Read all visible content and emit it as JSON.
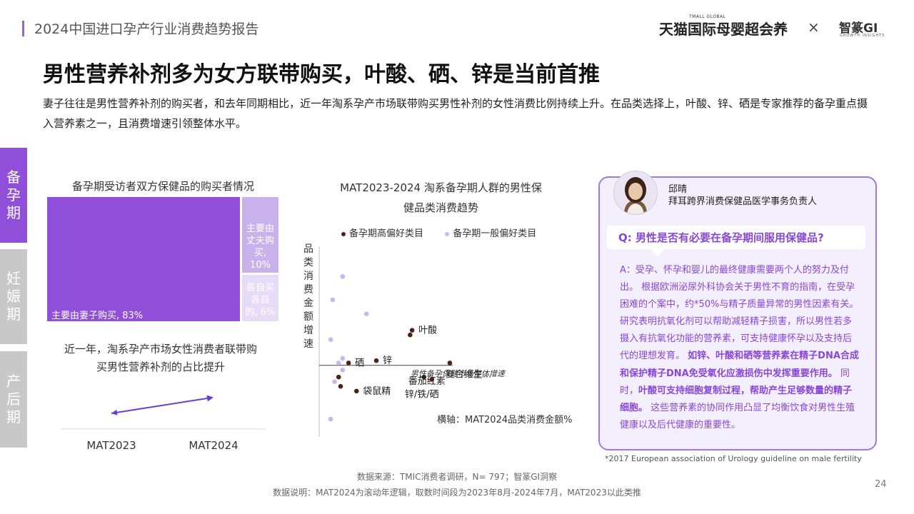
{
  "header": {
    "report_title": "2024中国进口孕产行业消费趋势报告",
    "brand_small": "TMALL GLOBAL",
    "brand_tmall": "天猫国际母婴超会养",
    "brand_x": "×",
    "brand_gi": "智篆GI",
    "brand_gi_sub": "GROWTH INSIGHTS"
  },
  "main_title": "男性营养补剂多为女方联带购买，叶酸、硒、锌是当前首推",
  "intro": "妻子往往是男性营养补剂的购买者，和去年同期相比，近一年淘系孕产市场联带购买男性补剂的女性消费比例持续上升。在品类选择上，叶酸、锌、硒是专家推荐的备孕重点摄入营养素之一，且消费增速引领整体水平。",
  "side_tabs": [
    {
      "label": "备孕期",
      "active": true
    },
    {
      "label": "妊娠期",
      "active": false
    },
    {
      "label": "产后期",
      "active": false
    }
  ],
  "colors": {
    "accent": "#8f4fd9",
    "accent_light": "#c9b2ec",
    "accent_lighter": "#e7dcf7",
    "dark_dot": "#4a2418",
    "light_dot": "#c8b6ee",
    "line": "#6a3fd0",
    "tab_inactive": "#c8c8c8"
  },
  "expert": {
    "name": "邱晴",
    "title": "拜耳跨界消费保健品医学事务负责人",
    "question": "Q:  男性是否有必要在备孕期间服用保健品?",
    "answer_plain_1": "A：受孕、怀孕和婴儿的最终健康需要两个人的努力及付出。 根据欧洲泌尿外科协会关于男性不育的指南，在受孕困难的个案中，约*50%与精子质量异常的男性因素有关。研究表明抗氧化剂可以帮助减轻精子损害，所以男性若多摄入有抗氧化功能的营养素，可支持健康怀孕以及支持后代的理想发育。",
    "answer_bold_1": "如锌、叶酸和硒等营养素在精子DNA合成和保护精子DNA免受氧化应激损伤中发挥重要作用。",
    "answer_plain_2": "同时，",
    "answer_bold_2": "叶酸可支持细胞复制过程，帮助产生足够数量的精子细胞。",
    "answer_plain_3": "这些营养素的协同作用凸显了均衡饮食对男性生殖健康以及后代健康的重要性。"
  },
  "footnote": "*2017 European association of Urology guideline on male fertility",
  "source": "数据来源：TMIC消费者调研，N= 797；智篆GI洞察",
  "source_note": "数据说明：MAT2024为滚动年逻辑，取数时间段为2023年8月-2024年7月，MAT2023以此类推",
  "page_number": "24",
  "chart_data": [
    {
      "type": "treemap",
      "title": "备孕期受访者双方保健品的购买者情况",
      "items": [
        {
          "label": "主要由妻子购买, 83%",
          "value": 83
        },
        {
          "label": "主要由丈夫购买, 10%",
          "value": 10
        },
        {
          "label": "各自买各自的, 6%",
          "value": 6
        }
      ]
    },
    {
      "type": "line",
      "caption": "近一年，淘系孕产市场女性消费者联带购买男性营养补剂的占比提升",
      "categories": [
        "MAT2023",
        "MAT2024"
      ],
      "values": [
        0.3,
        0.62
      ],
      "ylim": [
        0,
        1
      ]
    },
    {
      "type": "scatter",
      "title": "MAT2023-2024 淘系备孕期人群的男性保健品类消费趋势",
      "xlabel": "横轴：MAT2024品类消费金额%",
      "ylabel": "品类消费金额增速",
      "xlim": [
        0,
        100
      ],
      "ylim": [
        -30,
        50
      ],
      "reference_line": {
        "label": "男性备孕保健市场整体增速",
        "y": 0
      },
      "series": [
        {
          "name": "备孕期高偏好类目",
          "points": [
            {
              "x": 45,
              "y": 15,
              "label": "叶酸"
            },
            {
              "x": 44,
              "y": 13,
              "label": ""
            },
            {
              "x": 13,
              "y": 1,
              "label": "硒"
            },
            {
              "x": 8,
              "y": -5,
              "label": ""
            },
            {
              "x": 27,
              "y": 2,
              "label": "锌"
            },
            {
              "x": 51,
              "y": -5,
              "label": "番茄红素"
            },
            {
              "x": 64,
              "y": 1,
              "label": "复合维生..."
            },
            {
              "x": 55,
              "y": -6,
              "label": "锌/铁/硒"
            },
            {
              "x": 17,
              "y": -11,
              "label": "袋鼠精"
            },
            {
              "x": 9,
              "y": -9,
              "label": ""
            }
          ]
        },
        {
          "name": "备孕期一般偏好类目",
          "points": [
            {
              "x": 10,
              "y": 38,
              "label": ""
            },
            {
              "x": 5,
              "y": 28,
              "label": ""
            },
            {
              "x": 22,
              "y": 22,
              "label": ""
            },
            {
              "x": 4,
              "y": 11,
              "label": ""
            },
            {
              "x": 10,
              "y": 3,
              "label": ""
            },
            {
              "x": 8,
              "y": 1,
              "label": ""
            },
            {
              "x": 6,
              "y": -7,
              "label": ""
            },
            {
              "x": 10,
              "y": -2,
              "label": ""
            },
            {
              "x": 4,
              "y": -23,
              "label": ""
            }
          ]
        }
      ]
    }
  ]
}
